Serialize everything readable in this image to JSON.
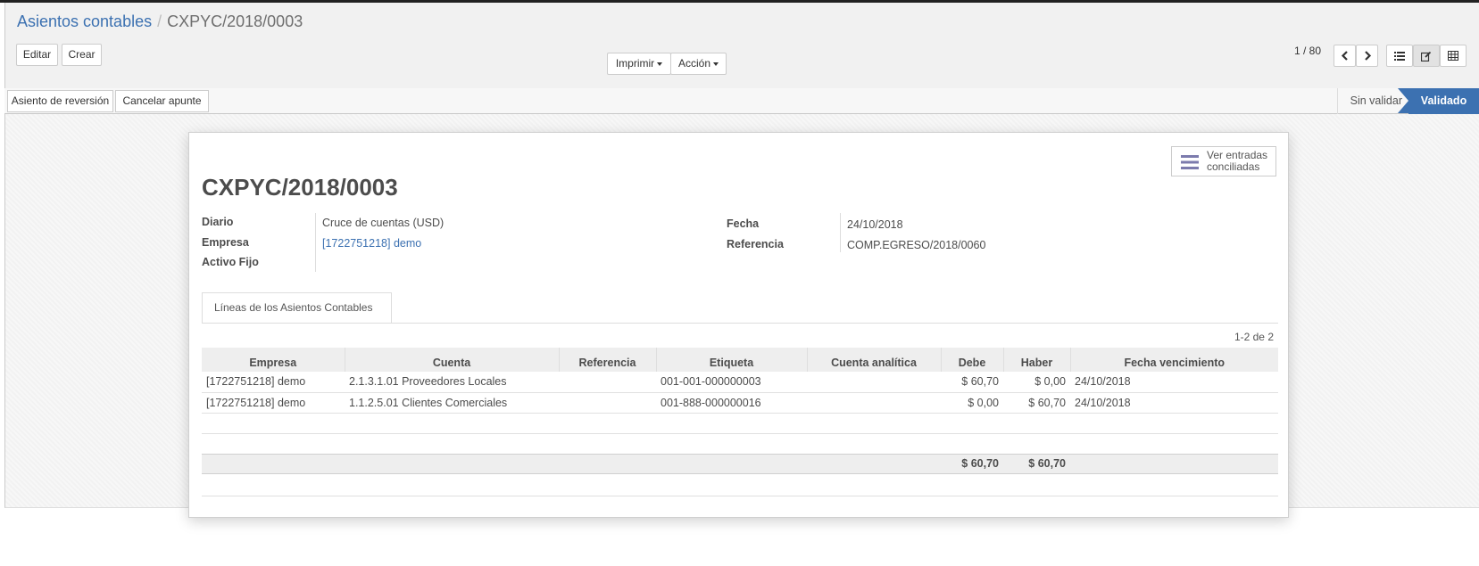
{
  "breadcrumb": {
    "parent": "Asientos contables",
    "current": "CXPYC/2018/0003"
  },
  "toolbar": {
    "edit_label": "Editar",
    "create_label": "Crear",
    "print_label": "Imprimir",
    "action_label": "Acción"
  },
  "pager": {
    "value": "1 / 80",
    "prev_icon": "chevron-left-icon",
    "next_icon": "chevron-right-icon"
  },
  "view_switcher": [
    "list-view-icon",
    "form-view-icon",
    "pivot-view-icon"
  ],
  "statusbar": {
    "buttons": [
      "Asiento de reversión",
      "Cancelar apunte"
    ],
    "stages": [
      {
        "label": "Sin validar",
        "active": false
      },
      {
        "label": "Validado",
        "active": true
      }
    ],
    "active_color": "#3c71b1"
  },
  "smart_button": {
    "line1": "Ver entradas",
    "line2": "conciliadas",
    "icon": "list-icon"
  },
  "form": {
    "title": "CXPYC/2018/0003",
    "left_fields": [
      {
        "label": "Diario",
        "value": "Cruce de cuentas (USD)"
      },
      {
        "label": "Empresa",
        "value": "[1722751218] demo"
      },
      {
        "label": "Activo Fijo",
        "value": ""
      }
    ],
    "right_fields": [
      {
        "label": "Fecha",
        "value": "24/10/2018"
      },
      {
        "label": "Referencia",
        "value": "COMP.EGRESO/2018/0060"
      }
    ]
  },
  "tab": {
    "label": "Líneas de los Asientos Contables"
  },
  "lines": {
    "pager": "1-2 de 2",
    "columns": [
      "Empresa",
      "Cuenta",
      "Referencia",
      "Etiqueta",
      "Cuenta analítica",
      "Debe",
      "Haber",
      "Fecha vencimiento"
    ],
    "rows": [
      [
        "[1722751218] demo",
        "2.1.3.1.01 Proveedores Locales",
        "",
        "001-001-000000003",
        "",
        "$ 60,70",
        "$ 0,00",
        "24/10/2018"
      ],
      [
        "[1722751218] demo",
        "1.1.2.5.01 Clientes Comerciales",
        "",
        "001-888-000000016",
        "",
        "$ 0,00",
        "$ 60,70",
        "24/10/2018"
      ]
    ],
    "totals": {
      "debe": "$ 60,70",
      "haber": "$ 60,70"
    }
  }
}
